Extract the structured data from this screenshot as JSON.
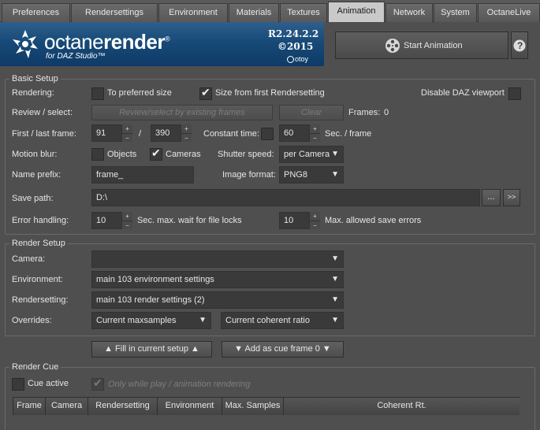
{
  "tabs": [
    "Preferences",
    "Rendersettings",
    "Environment",
    "Materials",
    "Textures",
    "Animation",
    "Network",
    "System",
    "OctaneLive"
  ],
  "active_tab": "Animation",
  "logo": {
    "name_light": "octane",
    "name_bold": "render",
    "trademark": "®",
    "subtitle": "for DAZ Studio™",
    "version": "R2.24.2.2",
    "year": "©2015",
    "brand": "otoy"
  },
  "header": {
    "start_button": "Start Animation",
    "help_button": "?"
  },
  "basic_setup": {
    "title": "Basic Setup",
    "rendering_label": "Rendering:",
    "to_preferred_size": "To preferred size",
    "to_preferred_size_checked": false,
    "size_from_first": "Size from first Rendersetting",
    "size_from_first_checked": true,
    "disable_daz_viewport": "Disable DAZ viewport",
    "disable_daz_viewport_checked": false,
    "review_label": "Review / select:",
    "review_button": "Review/select by existing frames",
    "clear_button": "Clear",
    "frames_text": "Frames:",
    "frames_count": "0",
    "first_last_label": "First / last frame:",
    "first_frame": "91",
    "separator": "/",
    "last_frame": "390",
    "constant_time_label": "Constant time:",
    "constant_time_checked": false,
    "seconds_per_frame": "60",
    "sec_frame_label": "Sec. / frame",
    "motion_blur_label": "Motion blur:",
    "objects_label": "Objects",
    "objects_checked": false,
    "cameras_label": "Cameras",
    "cameras_checked": true,
    "shutter_speed_label": "Shutter speed:",
    "shutter_speed_value": "per Camera",
    "name_prefix_label": "Name prefix:",
    "name_prefix_value": "frame_",
    "image_format_label": "Image format:",
    "image_format_value": "PNG8",
    "save_path_label": "Save path:",
    "save_path_value": "D:\\",
    "browse_button": "...",
    "go_button": ">>",
    "error_handling_label": "Error handling:",
    "wait_value": "10",
    "wait_label": "Sec. max. wait for file locks",
    "errors_value": "10",
    "errors_label": "Max. allowed save errors"
  },
  "render_setup": {
    "title": "Render Setup",
    "camera_label": "Camera:",
    "camera_value": "",
    "environment_label": "Environment:",
    "environment_value": "main 103 environment settings",
    "rendersetting_label": "Rendersetting:",
    "rendersetting_value": "main 103 render settings (2)",
    "overrides_label": "Overrides:",
    "override1_value": "Current maxsamples",
    "override2_value": "Current coherent ratio"
  },
  "actions": {
    "fill_button": "▲ Fill in current setup ▲",
    "add_button": "▼ Add as cue frame 0 ▼"
  },
  "render_cue": {
    "title": "Render Cue",
    "cue_active_label": "Cue active",
    "cue_active_checked": false,
    "only_while_play_label": "Only while play / animation rendering",
    "only_while_play_checked": true,
    "columns": [
      "Frame",
      "Camera",
      "Rendersetting",
      "Environment",
      "Max. Samples",
      "Coherent Rt."
    ]
  }
}
